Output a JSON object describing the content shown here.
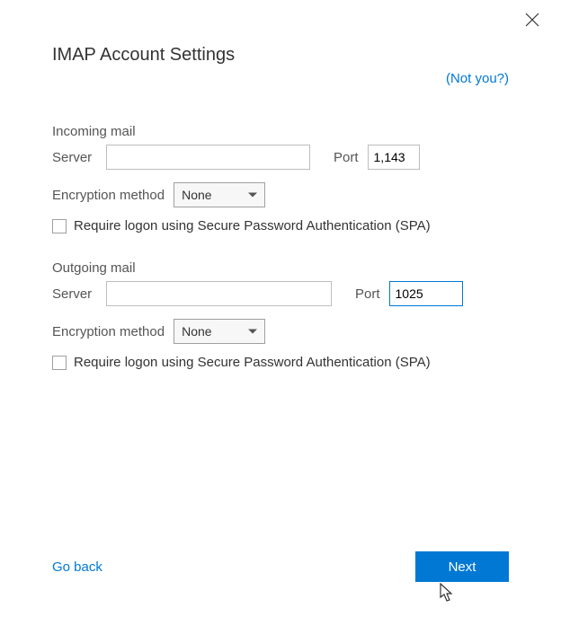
{
  "title": "IMAP Account Settings",
  "not_you_link": "(Not you?)",
  "incoming": {
    "section": "Incoming mail",
    "server_label": "Server",
    "server_value": "",
    "port_label": "Port",
    "port_value": "1,143",
    "enc_label": "Encryption method",
    "enc_value": "None",
    "spa_label": "Require logon using Secure Password Authentication (SPA)"
  },
  "outgoing": {
    "section": "Outgoing mail",
    "server_label": "Server",
    "server_value": "",
    "port_label": "Port",
    "port_value": "1025",
    "enc_label": "Encryption method",
    "enc_value": "None",
    "spa_label": "Require logon using Secure Password Authentication (SPA)"
  },
  "footer": {
    "goback": "Go back",
    "next": "Next"
  }
}
